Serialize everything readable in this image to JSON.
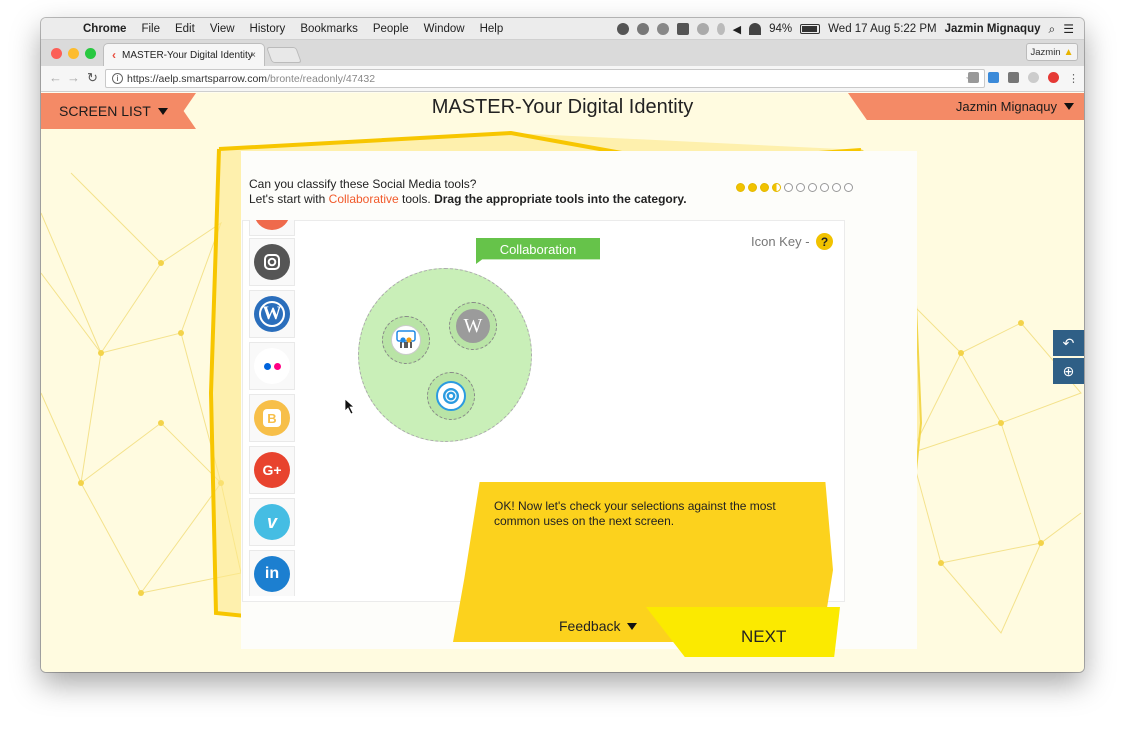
{
  "menubar": {
    "app": "Chrome",
    "items": [
      "File",
      "Edit",
      "View",
      "History",
      "Bookmarks",
      "People",
      "Window",
      "Help"
    ],
    "battery": "94%",
    "datetime": "Wed 17 Aug  5:22 PM",
    "user": "Jazmin Mignaquy"
  },
  "browser": {
    "tab_title": "MASTER-Your Digital Identity",
    "tab_close": "×",
    "profile_name": "Jazmin",
    "url_host": "https://aelp.smartsparrow.com",
    "url_path": "/bronte/readonly/47432"
  },
  "page": {
    "screen_list": "SCREEN LIST",
    "title": "MASTER-Your Digital Identity",
    "user": "Jazmin Mignaquy",
    "question_line1": "Can you classify these Social Media tools?",
    "question_line2_prefix": "Let's start with ",
    "question_highlight": "Collaborative",
    "question_line2_mid": " tools. ",
    "question_bold": "Drag the appropriate tools into the category.",
    "progress": {
      "completed": 3.5,
      "total": 10
    },
    "icon_key": "Icon Key -",
    "help_symbol": "?",
    "category_label": "Collaboration",
    "palette_icons": [
      "instagram-icon",
      "wordpress-icon",
      "flickr-icon",
      "blogger-icon",
      "google-plus-icon",
      "vimeo-icon",
      "linkedin-icon"
    ],
    "palette_glyphs": {
      "wordpress": "W",
      "blogger": "B",
      "google_plus": "G+",
      "vimeo": "v",
      "linkedin": "in"
    },
    "dropped_icons": [
      "slideshare-icon",
      "wikipedia-icon",
      "prezi-icon"
    ],
    "wikipedia_glyph": "W",
    "feedback_message": "OK! Now let's check your selections against the most common uses on the next screen.",
    "feedback_label": "Feedback",
    "next_label": "NEXT"
  },
  "colors": {
    "accent_orange": "#f48a66",
    "highlight": "#f15a2b",
    "yellow": "#fcd21d",
    "green": "#66c34a",
    "side_button": "#2f5f86"
  }
}
